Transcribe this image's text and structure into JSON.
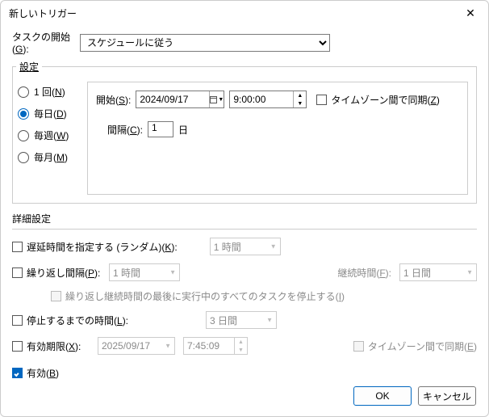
{
  "title": "新しいトリガー",
  "close_icon": "✕",
  "begin": {
    "label_pre": "タスクの開始(",
    "label_u": "G",
    "label_post": "):",
    "value": "スケジュールに従う"
  },
  "settings": {
    "legend": "設定",
    "radios": {
      "once_pre": "1 回(",
      "once_u": "N",
      "once_post": ")",
      "daily_pre": "毎日(",
      "daily_u": "D",
      "daily_post": ")",
      "weekly_pre": "毎週(",
      "weekly_u": "W",
      "weekly_post": ")",
      "monthly_pre": "毎月(",
      "monthly_u": "M",
      "monthly_post": ")"
    },
    "start_label_pre": "開始(",
    "start_label_u": "S",
    "start_label_post": "):",
    "date": "2024/09/17",
    "time": "9:00:00",
    "tz_pre": "タイムゾーン間で同期(",
    "tz_u": "Z",
    "tz_post": ")",
    "interval_label_pre": "間隔(",
    "interval_label_u": "C",
    "interval_label_post": "):",
    "interval_value": "1",
    "interval_unit": "日"
  },
  "adv": {
    "title": "詳細設定",
    "delay_pre": "遅延時間を指定する (ランダム)(",
    "delay_u": "K",
    "delay_post": "):",
    "delay_value": "1 時間",
    "repeat_pre": "繰り返し間隔(",
    "repeat_u": "P",
    "repeat_post": "):",
    "repeat_value": "1 時間",
    "duration_label_pre": "継続時間(",
    "duration_label_u": "F",
    "duration_label_post": "):",
    "duration_value": "1 日間",
    "stop_all_pre": "繰り返し継続時間の最後に実行中のすべてのタスクを停止する(",
    "stop_all_u": "I",
    "stop_all_post": ")",
    "stop_after_pre": "停止するまでの時間(",
    "stop_after_u": "L",
    "stop_after_post": "):",
    "stop_after_value": "3 日間",
    "expire_pre": "有効期限(",
    "expire_u": "X",
    "expire_post": "):",
    "expire_date": "2025/09/17",
    "expire_time": "7:45:09",
    "expire_tz_pre": "タイムゾーン間で同期(",
    "expire_tz_u": "E",
    "expire_tz_post": ")",
    "enabled_pre": "有効(",
    "enabled_u": "B",
    "enabled_post": ")"
  },
  "buttons": {
    "ok": "OK",
    "cancel": "キャンセル"
  },
  "glyphs": {
    "up": "▲",
    "down": "▼",
    "dd": "▼"
  }
}
